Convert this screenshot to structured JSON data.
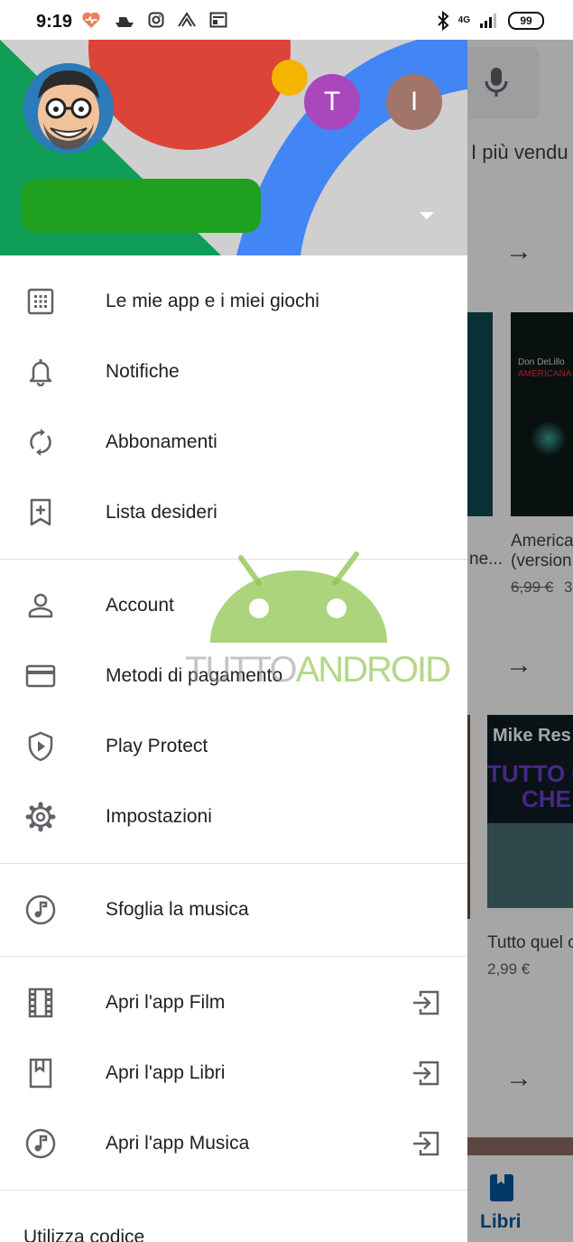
{
  "status_bar": {
    "time": "9:19",
    "network": "4G",
    "battery": "99",
    "icons": [
      "health-icon",
      "boat-icon",
      "instagram-icon",
      "mountain-icon",
      "news-icon",
      "bluetooth-icon",
      "signal-icon"
    ]
  },
  "drawer": {
    "header": {
      "account_initials": [
        "T",
        "I"
      ],
      "account_colors": [
        "#ab47bc",
        "#a1756a"
      ]
    },
    "sections": [
      [
        {
          "icon": "apps-grid-icon",
          "label": "Le mie app e i miei giochi"
        },
        {
          "icon": "bell-icon",
          "label": "Notifiche"
        },
        {
          "icon": "sync-icon",
          "label": "Abbonamenti"
        },
        {
          "icon": "bookmark-add-icon",
          "label": "Lista desideri"
        }
      ],
      [
        {
          "icon": "person-icon",
          "label": "Account"
        },
        {
          "icon": "credit-card-icon",
          "label": "Metodi di pagamento"
        },
        {
          "icon": "shield-play-icon",
          "label": "Play Protect"
        },
        {
          "icon": "gear-icon",
          "label": "Impostazioni"
        }
      ],
      [
        {
          "icon": "music-note-icon",
          "label": "Sfoglia la musica"
        }
      ],
      [
        {
          "icon": "film-icon",
          "label": "Apri l'app Film",
          "ext": "open-external-icon"
        },
        {
          "icon": "book-icon",
          "label": "Apri l'app Libri",
          "ext": "open-external-icon"
        },
        {
          "icon": "music-note-icon",
          "label": "Apri l'app Musica",
          "ext": "open-external-icon"
        }
      ]
    ],
    "redeem_label": "Utilizza codice"
  },
  "background": {
    "chip_label": "I più vendu",
    "book1_author": "Don DeLillo",
    "book1_series": "AMERICANA",
    "book1_title_line1": "America",
    "book1_title_line2": "(version",
    "book1_old_price": "6,99 €",
    "book1_new_price": "3",
    "book0_title": "ne...",
    "book2_author": "Mike Res",
    "book2_cover_line1": "TUTTO Q",
    "book2_cover_line2": "CHE",
    "book2_title": "Tutto quel c",
    "book2_price": "2,99 €",
    "bottom_nav_label": "Libri"
  },
  "watermark": {
    "part1": "TUTTO",
    "part2": "ANDROID"
  },
  "colors": {
    "header_red": "#db4437",
    "header_blue": "#4285f4",
    "header_green": "#0f9d58",
    "header_yellow": "#f4b400",
    "scrim": "rgba(0,0,0,0.35)",
    "libri_blue": "#01579b"
  }
}
